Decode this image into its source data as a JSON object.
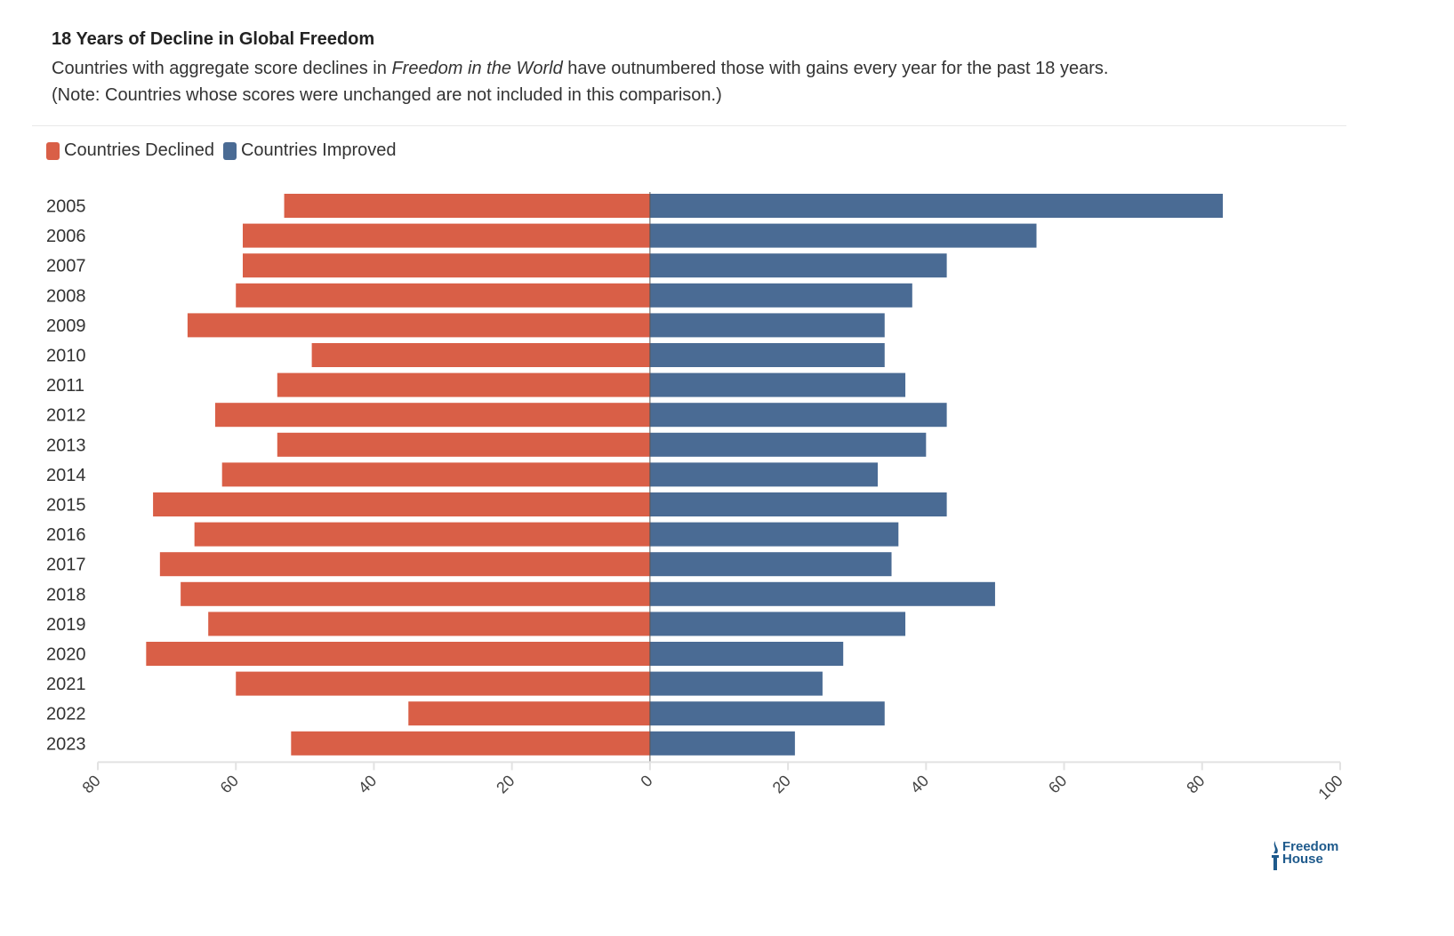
{
  "header": {
    "title": "18 Years of Decline in Global Freedom",
    "subtitle_pre": "Countries with aggregate score declines in ",
    "subtitle_em": "Freedom in the World",
    "subtitle_post": " have outnumbered those with gains every year for the past 18 years.",
    "note": "(Note: Countries whose scores were unchanged are not included in this comparison.)"
  },
  "legend": [
    {
      "label": "Countries Declined",
      "color": "#d95f47"
    },
    {
      "label": "Countries Improved",
      "color": "#4a6b94"
    }
  ],
  "logo": {
    "line1": "Freedom",
    "line2": "House"
  },
  "chart_data": {
    "type": "bar",
    "orientation": "horizontal-diverging",
    "title": "18 Years of Decline in Global Freedom",
    "xlabel": "",
    "ylabel": "",
    "categories": [
      "2005",
      "2006",
      "2007",
      "2008",
      "2009",
      "2010",
      "2011",
      "2012",
      "2013",
      "2014",
      "2015",
      "2016",
      "2017",
      "2018",
      "2019",
      "2020",
      "2021",
      "2022",
      "2023"
    ],
    "series": [
      {
        "name": "Countries Declined",
        "color": "#d95f47",
        "direction": "left",
        "values": [
          53,
          59,
          59,
          60,
          67,
          49,
          54,
          63,
          54,
          62,
          72,
          66,
          71,
          68,
          64,
          73,
          60,
          35,
          52
        ]
      },
      {
        "name": "Countries Improved",
        "color": "#4a6b94",
        "direction": "right",
        "values": [
          83,
          56,
          43,
          38,
          34,
          34,
          37,
          43,
          40,
          33,
          43,
          36,
          35,
          50,
          37,
          28,
          25,
          34,
          21
        ]
      }
    ],
    "xlim": [
      -80,
      100
    ],
    "xticks": [
      -80,
      -60,
      -40,
      -20,
      0,
      20,
      40,
      60,
      80,
      100
    ],
    "xtick_labels": [
      "80",
      "60",
      "40",
      "20",
      "0",
      "20",
      "40",
      "60",
      "80",
      "100"
    ],
    "grid": false,
    "legend_position": "top-left"
  }
}
